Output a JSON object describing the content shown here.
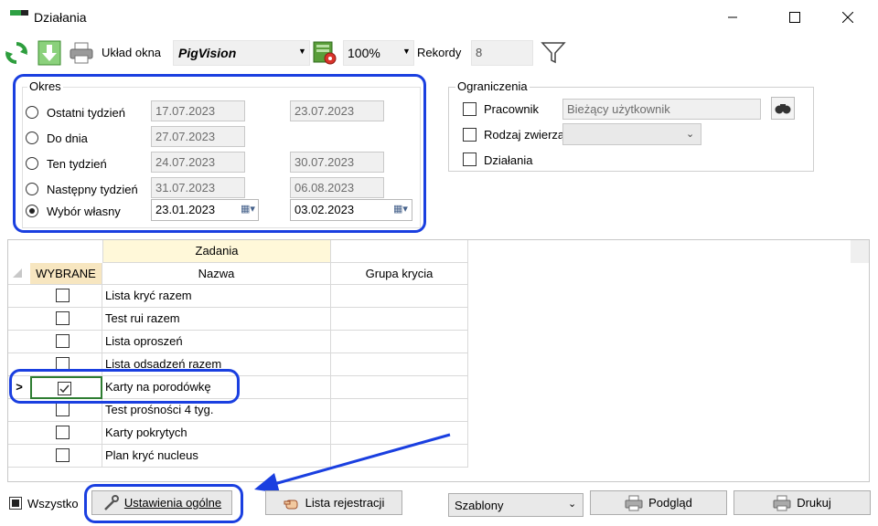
{
  "window": {
    "title": "Działania"
  },
  "toolbar": {
    "layout_label": "Układ okna",
    "layout_value": "PigVision",
    "zoom_value": "100%",
    "records_label": "Rekordy",
    "records_value": "8"
  },
  "period": {
    "legend": "Okres",
    "options": [
      {
        "label": "Ostatni tydzień",
        "from": "17.07.2023",
        "to": "23.07.2023",
        "selected": false
      },
      {
        "label": "Do dnia",
        "from": "27.07.2023",
        "to": "",
        "selected": false
      },
      {
        "label": "Ten tydzień",
        "from": "24.07.2023",
        "to": "30.07.2023",
        "selected": false
      },
      {
        "label": "Następny tydzień",
        "from": "31.07.2023",
        "to": "06.08.2023",
        "selected": false
      },
      {
        "label": "Wybór własny",
        "from": "23.01.2023",
        "to": "03.02.2023",
        "selected": true
      }
    ]
  },
  "limits": {
    "legend": "Ograniczenia",
    "employee_label": "Pracownik",
    "employee_value": "Bieżący użytkownik",
    "animal_type_label": "Rodzaj zwierzą",
    "animal_type_value": "",
    "actions_label": "Działania"
  },
  "grid": {
    "group_header": "Zadania",
    "columns": [
      "WYBRANE",
      "Nazwa",
      "Grupa krycia"
    ],
    "current_row_marker": ">",
    "rows": [
      {
        "name": "Lista kryć razem",
        "group": "",
        "checked": false,
        "current": false
      },
      {
        "name": "Test rui razem",
        "group": "",
        "checked": false,
        "current": false
      },
      {
        "name": "Lista oproszeń",
        "group": "",
        "checked": false,
        "current": false
      },
      {
        "name": "Lista odsadzeń razem",
        "group": "",
        "checked": false,
        "current": false
      },
      {
        "name": "Karty na porodówkę",
        "group": "",
        "checked": true,
        "current": true
      },
      {
        "name": "Test prośności 4 tyg.",
        "group": "",
        "checked": false,
        "current": false
      },
      {
        "name": "Karty pokrytych",
        "group": "",
        "checked": false,
        "current": false
      },
      {
        "name": "Plan kryć nucleus",
        "group": "",
        "checked": false,
        "current": false
      }
    ]
  },
  "footer": {
    "all_label": "Wszystko",
    "general_settings_label": "Ustawienia ogólne",
    "registration_list_label": "Lista rejestracji",
    "templates_value": "Szablony",
    "preview_label": "Podgląd",
    "print_label": "Drukuj"
  },
  "colors": {
    "highlight": "#1a3fe0",
    "group_header_bg": "#fff8d9",
    "wybrane_bg": "#f7e6c0",
    "selection_green": "#2e7d32"
  }
}
